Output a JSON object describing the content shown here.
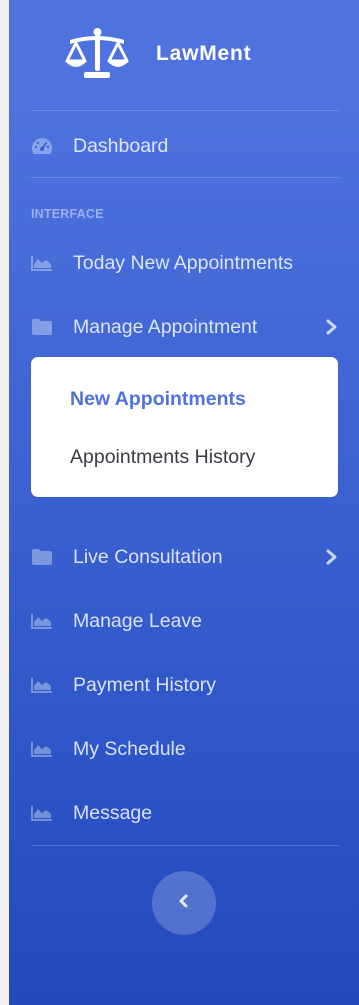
{
  "brand": {
    "name": "LawMent",
    "icon": "scales-of-justice-icon"
  },
  "nav": {
    "dashboard": {
      "label": "Dashboard",
      "icon": "tachometer-icon"
    },
    "heading": "INTERFACE",
    "items": [
      {
        "label": "Today New Appointments",
        "icon": "area-chart-icon"
      },
      {
        "label": "Manage Appointment",
        "icon": "folder-icon",
        "chevron": true
      },
      {
        "label": "Live Consultation",
        "icon": "folder-icon",
        "chevron": true
      },
      {
        "label": "Manage Leave",
        "icon": "area-chart-icon"
      },
      {
        "label": "Payment History",
        "icon": "area-chart-icon"
      },
      {
        "label": "My Schedule",
        "icon": "area-chart-icon"
      },
      {
        "label": "Message",
        "icon": "area-chart-icon"
      }
    ],
    "submenu": [
      {
        "label": "New Appointments",
        "active": true
      },
      {
        "label": "Appointments History",
        "active": false
      }
    ]
  },
  "toggle": {
    "icon": "chevron-left-icon"
  },
  "colors": {
    "sidebar_top": "#4e73df",
    "sidebar_bottom": "#224abe",
    "active_link": "#4e73df",
    "submenu_text": "#3a3b45"
  }
}
